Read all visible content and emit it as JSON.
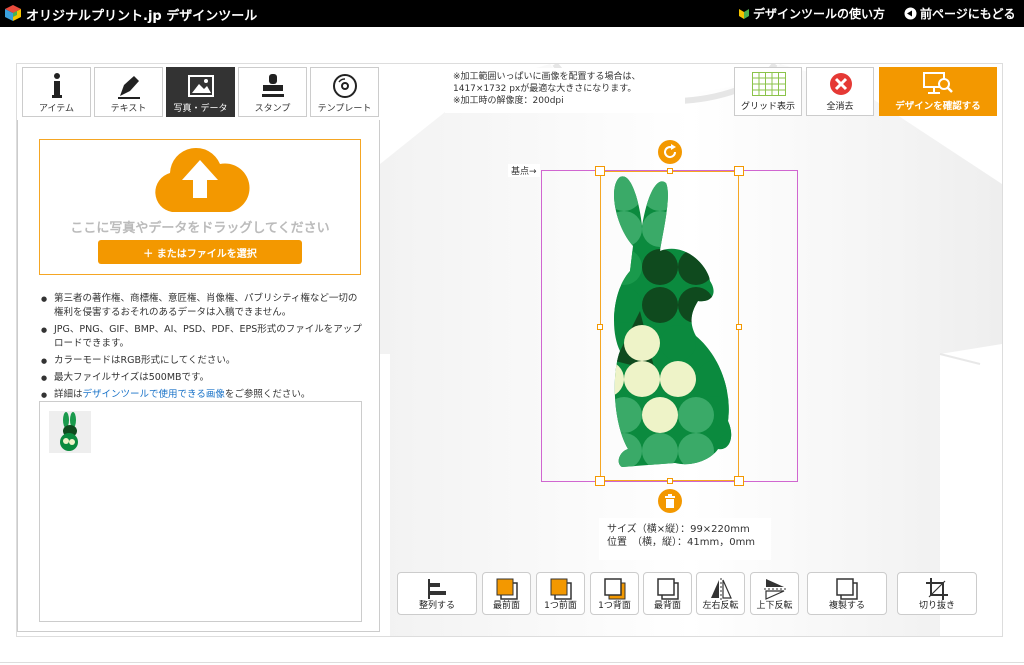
{
  "header": {
    "brand": "オリジナルプリント.jp デザインツール",
    "link_howto": "デザインツールの使い方",
    "link_back": "前ページにもどる"
  },
  "tabs": [
    {
      "label": "アイテム",
      "icon": "info-icon"
    },
    {
      "label": "テキスト",
      "icon": "pen-icon"
    },
    {
      "label": "写真・データ",
      "icon": "image-icon",
      "active": true
    },
    {
      "label": "スタンプ",
      "icon": "stamp-icon"
    },
    {
      "label": "テンプレート",
      "icon": "disc-icon"
    }
  ],
  "upload": {
    "drop_text": "ここに写真やデータをドラッグしてください",
    "file_button": "＋ またはファイルを選択"
  },
  "notes": {
    "n1": "第三者の著作権、商標権、意匠権、肖像権、パブリシティ権など一切の権利を侵害するおそれのあるデータは入稿できません。",
    "n2": "JPG、PNG、GIF、BMP、AI、PSD、PDF、EPS形式のファイルをアップロードできます。",
    "n3": "カラーモードはRGB形式にしてください。",
    "n4": "最大ファイルサイズは500MBです。",
    "n5_pre": "詳細は",
    "n5_link": "デザインツールで使用できる画像",
    "n5_post": "をご参照ください。"
  },
  "info": {
    "line1": "※加工範囲いっぱいに画像を配置する場合は、",
    "line2": "1417×1732 pxが最適な大きさになります。",
    "line3": "※加工時の解像度：200dpi"
  },
  "toolbar": {
    "grid": "グリッド表示",
    "clear": "全消去",
    "confirm": "デザインを確認する"
  },
  "canvas": {
    "basepoint": "基点→",
    "size_line": "サイズ（横×縦）：99×220mm",
    "pos_line": "位置　（横，縦）：41mm，0mm"
  },
  "bottom": {
    "align": "整列する",
    "front": "最前面",
    "forward": "1つ前面",
    "backward": "1つ背面",
    "back": "最背面",
    "fliph": "左右反転",
    "flipv": "上下反転",
    "duplicate": "複製する",
    "crop": "切り抜き"
  },
  "colors": {
    "accent": "#f39800",
    "dark_green": "#0f4a1e",
    "green": "#0b8a3e",
    "light_green": "#3aaa68",
    "cream": "#eef3c8"
  }
}
